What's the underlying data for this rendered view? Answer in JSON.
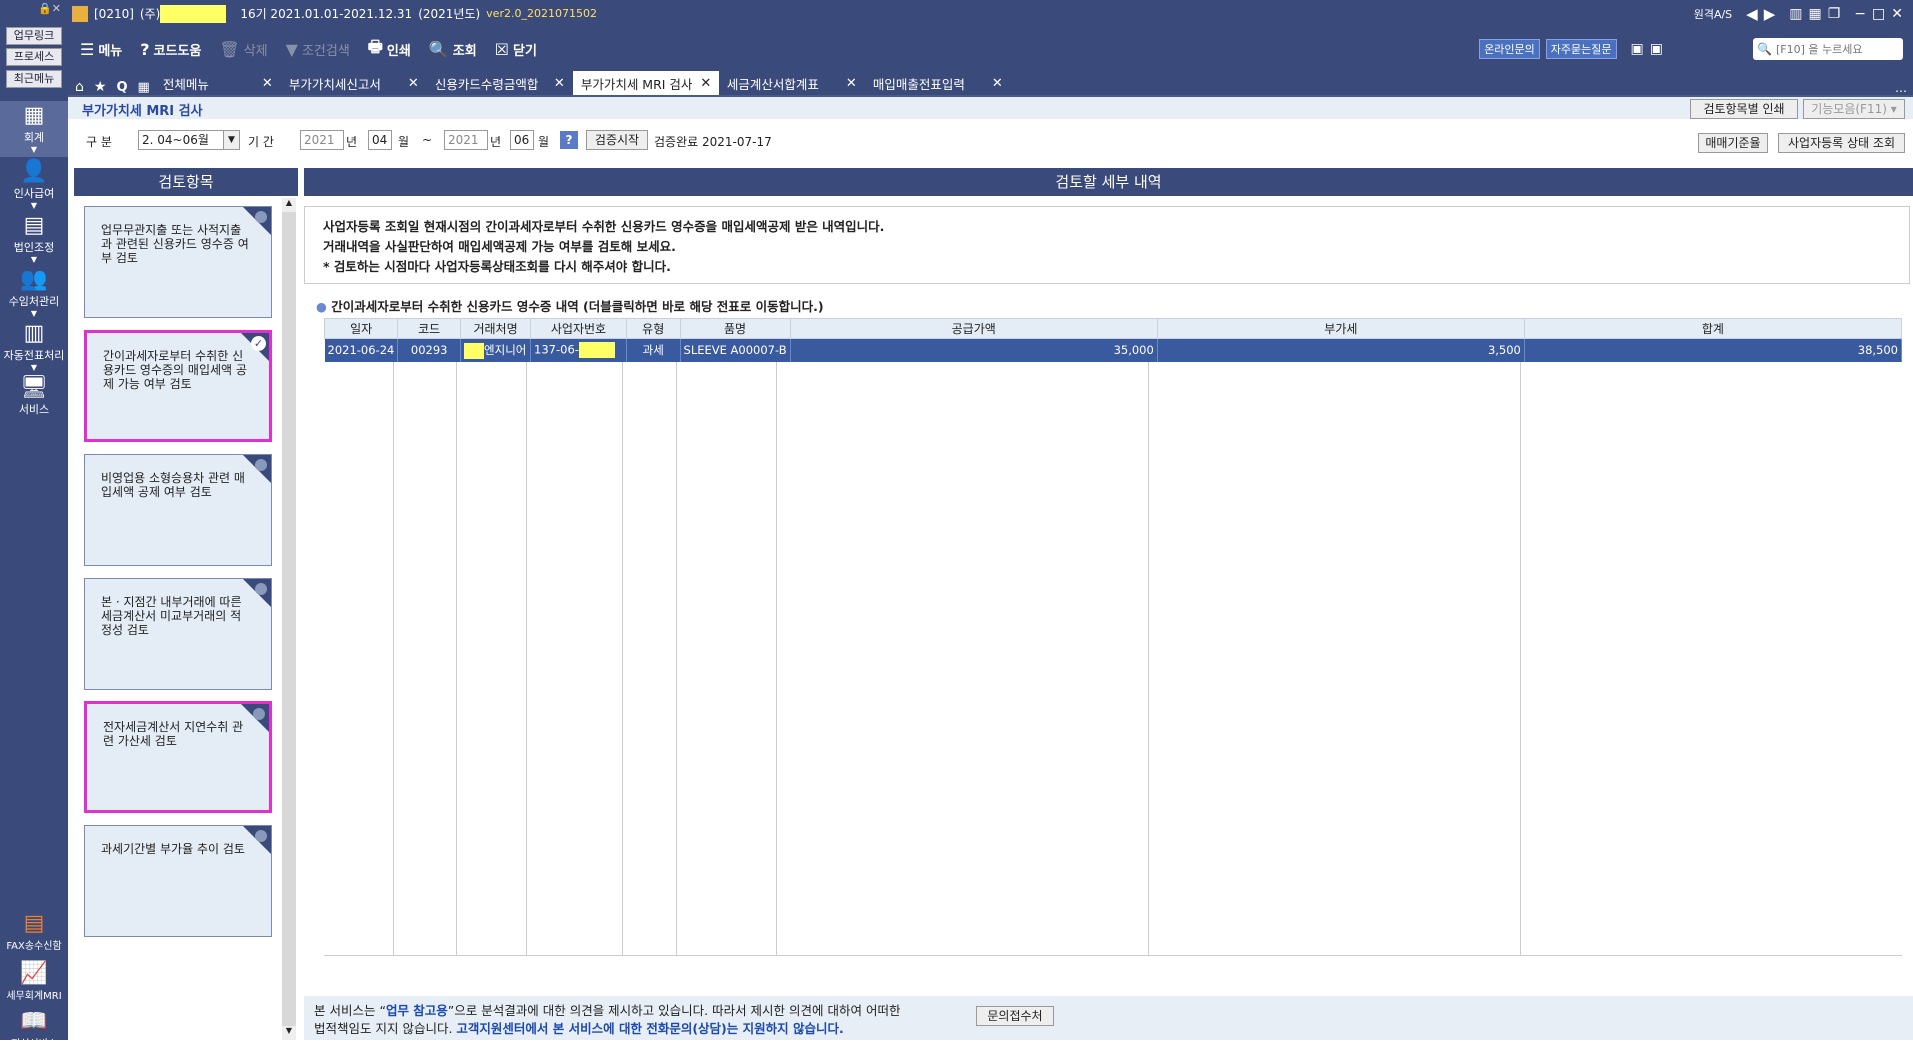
{
  "titlebar": {
    "code": "[0210]",
    "company_prefix": "(주)",
    "period": "16기 2021.01.01-2021.12.31",
    "year": "(2021년도)",
    "version": "ver2.0_2021071502",
    "remote": "원격A/S"
  },
  "toolbar": {
    "menu": "메뉴",
    "help": "코드도움",
    "delete": "삭제",
    "cond_search": "조건검색",
    "print": "인쇄",
    "lookup": "조회",
    "close": "닫기",
    "online": "온라인문의",
    "faq": "자주묻는질문",
    "search_placeholder": "[F10] 을 누르세요"
  },
  "tabs": [
    {
      "label": "전체메뉴"
    },
    {
      "label": "부가가치세신고서"
    },
    {
      "label": "신용카드수령금액합"
    },
    {
      "label": "부가가치세 MRI 검사"
    },
    {
      "label": "세금계산서합계표"
    },
    {
      "label": "매입매출전표입력"
    }
  ],
  "sidebar": {
    "quick": [
      "업무링크",
      "프로세스",
      "최근메뉴"
    ],
    "nav": [
      "회계",
      "인사급여",
      "법인조정",
      "수임처관리",
      "자동전표처리",
      "서비스"
    ],
    "bottom": [
      "FAX송수신함",
      "세무회계MRI",
      "지식서비스"
    ]
  },
  "page": {
    "title": "부가가치세 MRI 검사",
    "print_by_item": "검토항목별 인쇄",
    "func_collect": "기능모음(F11)"
  },
  "filter": {
    "gubun_label": "구  분",
    "gubun_value": "2. 04~06월",
    "period_label": "기  간",
    "year_from": "2021",
    "year_label": "년",
    "month_from": "04",
    "month_label": "월",
    "tilde": "~",
    "year_to": "2021",
    "month_to": "06",
    "start_btn": "검증시작",
    "completed": "검증완료 2021-07-17",
    "trade_std": "매매기준율",
    "biz_status": "사업자등록 상태 조회"
  },
  "left": {
    "header": "검토항목",
    "cards": [
      {
        "text": "업무무관지출 또는 사적지출과 관련된 신용카드 영수증 여부 검토"
      },
      {
        "text": "간이과세자로부터 수취한 신용카드 영수증의 매입세액 공제 가능 여부 검토"
      },
      {
        "text": "비영업용 소형승용차 관련 매입세액 공제 여부 검토"
      },
      {
        "text": "본 · 지점간 내부거래에 따른 세금계산서 미교부거래의 적정성 검토"
      },
      {
        "text": "전자세금계산서 지연수취 관련 가산세 검토"
      },
      {
        "text": "과세기간별 부가율 추이 검토"
      }
    ]
  },
  "right": {
    "header": "검토할 세부 내역",
    "desc": [
      "사업자등록 조회일 현재시점의 간이과세자로부터 수취한 신용카드 영수증을 매입세액공제 받은 내역입니다.",
      "거래내역을 사실판단하여 매입세액공제 가능 여부를 검토해 보세요.",
      "* 검토하는 시점마다 사업자등록상태조회를 다시 해주셔야 합니다."
    ],
    "section": "간이과세자로부터 수취한 신용카드 영수증 내역 (더블클릭하면 바로 해당 전표로 이동합니다.)",
    "columns": [
      "일자",
      "코드",
      "거래처명",
      "사업자번호",
      "유형",
      "품명",
      "공급가액",
      "부가세",
      "합계"
    ],
    "rows": [
      {
        "date": "2021-06-24",
        "code": "00293",
        "name": "엔지니어",
        "bizno": "137-06-",
        "type": "과세",
        "item": "SLEEVE A00007-B",
        "supply": "35,000",
        "vat": "3,500",
        "total": "38,500"
      }
    ]
  },
  "footer": {
    "line1_a": "본 서비스는 “",
    "line1_b": "업무 참고용",
    "line1_c": "”으로 분석결과에 대한 의견을 제시하고 있습니다. 따라서 제시한 의견에 대하여 어떠한",
    "line2_a": "법적책임도 지지 않습니다. ",
    "line2_b": "고객지원센터에서 본 서비스에 대한 전화문의(상담)는 지원하지 않습니다.",
    "contact": "문의접수처"
  }
}
